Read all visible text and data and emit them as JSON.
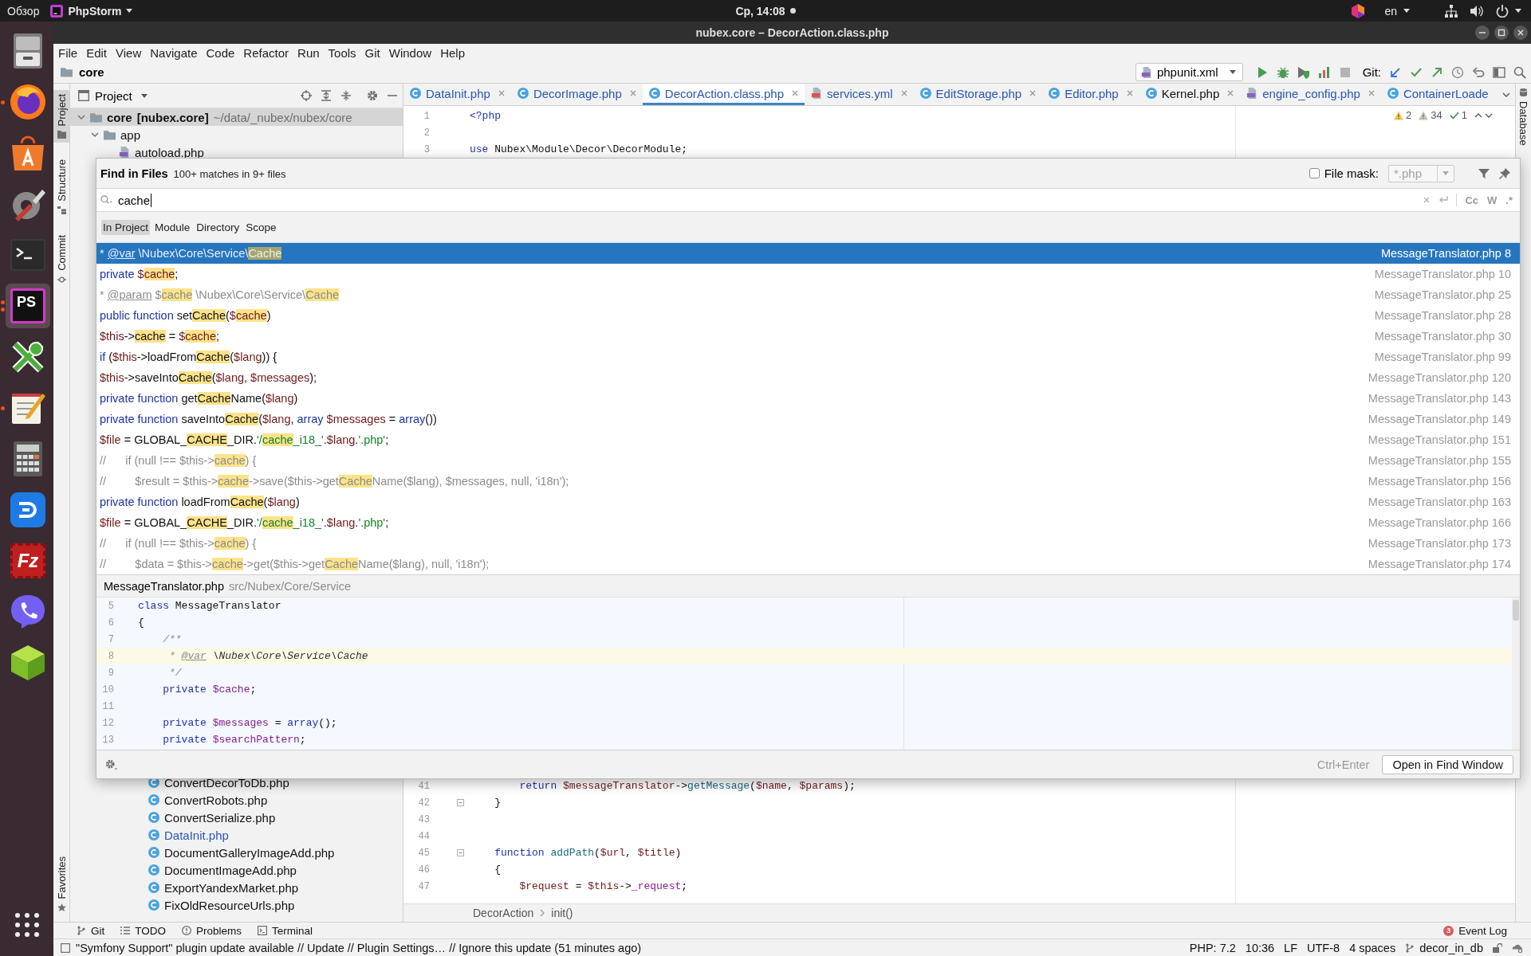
{
  "top_bar": {
    "activities": "Обзор",
    "app_name": "PhpStorm",
    "clock": "Ср, 14:08",
    "notification": true,
    "language": "en"
  },
  "dock": {
    "apps": [
      {
        "kind": "cabinet",
        "running": false,
        "multi_window": false,
        "active": false
      },
      {
        "kind": "browser",
        "running": true,
        "multi_window": false,
        "active": false
      },
      {
        "kind": "store",
        "running": false,
        "multi_window": false,
        "active": false
      },
      {
        "kind": "settings",
        "running": false,
        "multi_window": false,
        "active": false
      },
      {
        "kind": "terminal",
        "running": false,
        "multi_window": false,
        "active": false
      },
      {
        "kind": "ide",
        "label": "PS",
        "running": true,
        "multi_window": true,
        "active": true
      },
      {
        "kind": "keys",
        "running": false,
        "multi_window": false,
        "active": false
      },
      {
        "kind": "notepad",
        "running": true,
        "multi_window": false,
        "active": false
      },
      {
        "kind": "calculator",
        "running": false,
        "multi_window": false,
        "active": false
      },
      {
        "kind": "docs",
        "running": false,
        "multi_window": false,
        "active": false
      },
      {
        "kind": "ftp",
        "label": "Fz",
        "running": false,
        "multi_window": false,
        "active": false
      },
      {
        "kind": "phone",
        "running": false,
        "multi_window": false,
        "active": false
      },
      {
        "kind": "cube",
        "running": false,
        "multi_window": false,
        "active": false
      }
    ]
  },
  "window": {
    "title": "nubex.core – DecorAction.class.php"
  },
  "menu": [
    "File",
    "Edit",
    "View",
    "Navigate",
    "Code",
    "Refactor",
    "Run",
    "Tools",
    "Git",
    "Window",
    "Help"
  ],
  "nav_bar": {
    "crumb": "core",
    "run_config": "phpunit.xml",
    "git_label": "Git:"
  },
  "left_stripe": {
    "top": [
      {
        "kind": "project",
        "label": "Project",
        "selected": true
      },
      {
        "kind": "structure",
        "label": "Structure",
        "selected": false
      },
      {
        "kind": "commit",
        "label": "Commit",
        "selected": false
      }
    ],
    "bottom": [
      {
        "kind": "favorites",
        "label": "Favorites",
        "selected": false
      }
    ]
  },
  "project": {
    "title": "Project",
    "tree": [
      {
        "label": "core",
        "module": "[nubex.core]",
        "path": "~/data/_nubex/nubex/core",
        "kind": "folder",
        "expanded": true,
        "selected": true,
        "children": [
          {
            "label": "app",
            "kind": "folder",
            "expanded": true,
            "selected": false,
            "children": [
              {
                "label": "autoload.php",
                "kind": "php",
                "selected": false
              }
            ]
          }
        ]
      }
    ],
    "lower_files": [
      {
        "label": "ConvertDecorToDb.php",
        "modified": false
      },
      {
        "label": "ConvertRobots.php",
        "modified": false
      },
      {
        "label": "ConvertSerialize.php",
        "modified": false
      },
      {
        "label": "DataInit.php",
        "modified": true
      },
      {
        "label": "DocumentGalleryImageAdd.php",
        "modified": false
      },
      {
        "label": "DocumentImageAdd.php",
        "modified": false
      },
      {
        "label": "ExportYandexMarket.php",
        "modified": false
      },
      {
        "label": "FixOldResourceUrls.php",
        "modified": false
      }
    ]
  },
  "editor": {
    "tabs": [
      {
        "label": "DataInit.php",
        "kind": "class",
        "modified": true,
        "selected": false,
        "closable": true
      },
      {
        "label": "DecorImage.php",
        "kind": "class",
        "modified": true,
        "selected": false,
        "closable": true
      },
      {
        "label": "DecorAction.class.php",
        "kind": "class",
        "modified": true,
        "selected": true,
        "closable": true
      },
      {
        "label": "services.yml",
        "kind": "yaml",
        "modified": true,
        "selected": false,
        "closable": true
      },
      {
        "label": "EditStorage.php",
        "kind": "class",
        "modified": true,
        "selected": false,
        "closable": true
      },
      {
        "label": "Editor.php",
        "kind": "class",
        "modified": true,
        "selected": false,
        "closable": true
      },
      {
        "label": "Kernel.php",
        "kind": "class",
        "modified": false,
        "selected": false,
        "closable": true
      },
      {
        "label": "engine_config.php",
        "kind": "php",
        "modified": true,
        "selected": false,
        "closable": true
      },
      {
        "label": "ContainerLoade",
        "kind": "class",
        "modified": true,
        "selected": false,
        "closable": false
      }
    ],
    "inspections": {
      "warnings": "2",
      "weak_warnings": "34",
      "passed": "1"
    },
    "top_lines": [
      {
        "number": "1",
        "fold": false,
        "tokens": [
          {
            "text": "<?php",
            "kind": "keyword"
          }
        ]
      },
      {
        "number": "2",
        "fold": false
      },
      {
        "number": "3",
        "fold": false,
        "tokens": [
          {
            "text": "use ",
            "kind": "keyword"
          },
          {
            "text": "Nubex\\Module\\Decor\\DecorModule;",
            "kind": "plain"
          }
        ]
      }
    ],
    "bottom_lines": [
      {
        "number": "41",
        "fold": false,
        "tokens": [
          {
            "text": "        return ",
            "kind": "keyword"
          },
          {
            "text": "$messageTranslator",
            "kind": "variable"
          },
          {
            "text": "->",
            "kind": "plain"
          },
          {
            "text": "getMessage",
            "kind": "method"
          },
          {
            "text": "(",
            "kind": "plain"
          },
          {
            "text": "$name",
            "kind": "variable"
          },
          {
            "text": ", ",
            "kind": "plain"
          },
          {
            "text": "$params",
            "kind": "variable"
          },
          {
            "text": ");",
            "kind": "plain"
          }
        ]
      },
      {
        "number": "42",
        "fold": true,
        "tokens": [
          {
            "text": "    }",
            "kind": "plain"
          }
        ]
      },
      {
        "number": "43",
        "fold": false
      },
      {
        "number": "44",
        "fold": false
      },
      {
        "number": "45",
        "fold": true,
        "tokens": [
          {
            "text": "    function ",
            "kind": "keyword"
          },
          {
            "text": "addPath",
            "kind": "method"
          },
          {
            "text": "(",
            "kind": "plain"
          },
          {
            "text": "$url",
            "kind": "variable"
          },
          {
            "text": ", ",
            "kind": "plain"
          },
          {
            "text": "$title",
            "kind": "variable"
          },
          {
            "text": ")",
            "kind": "plain"
          }
        ]
      },
      {
        "number": "46",
        "fold": false,
        "tokens": [
          {
            "text": "    {",
            "kind": "plain"
          }
        ]
      },
      {
        "number": "47",
        "fold": false,
        "tokens": [
          {
            "text": "        $request",
            "kind": "variable"
          },
          {
            "text": " = ",
            "kind": "plain"
          },
          {
            "text": "$this",
            "kind": "variable"
          },
          {
            "text": "->",
            "kind": "plain"
          },
          {
            "text": "_request",
            "kind": "field"
          },
          {
            "text": ";",
            "kind": "plain"
          }
        ]
      }
    ],
    "breadcrumbs": [
      "DecorAction",
      "init()"
    ]
  },
  "right_stripe": [
    {
      "kind": "database",
      "label": "Database",
      "selected": false
    }
  ],
  "find_dialog": {
    "title": "Find in Files",
    "summary": "100+ matches in 9+ files",
    "file_mask": {
      "label": "File mask:",
      "checked": false,
      "value": "*.php"
    },
    "query": "cache",
    "options": [
      {
        "label": "Cc",
        "on": false
      },
      {
        "label": "W",
        "on": false
      },
      {
        "label": ".*",
        "on": false
      }
    ],
    "scopes": [
      {
        "label": "In Project",
        "selected": true
      },
      {
        "label": "Module",
        "selected": false
      },
      {
        "label": "Directory",
        "selected": false
      },
      {
        "label": "Scope",
        "selected": false
      }
    ],
    "results": [
      {
        "selected": true,
        "file": "MessageTranslator.php",
        "line": "8",
        "tokens": [
          {
            "text": "* ",
            "kind": "comment",
            "match": false
          },
          {
            "text": "@var",
            "kind": "doctag",
            "match": false
          },
          {
            "text": " \\Nubex\\Core\\Service\\",
            "kind": "comment",
            "match": false
          },
          {
            "text": "Cache",
            "kind": "comment",
            "match": true
          }
        ]
      },
      {
        "selected": false,
        "file": "MessageTranslator.php",
        "line": "10",
        "tokens": [
          {
            "text": "private ",
            "kind": "keyword",
            "match": false
          },
          {
            "text": "$",
            "kind": "variable",
            "match": false
          },
          {
            "text": "cache",
            "kind": "variable",
            "match": true
          },
          {
            "text": ";",
            "kind": "plain",
            "match": false
          }
        ]
      },
      {
        "selected": false,
        "file": "MessageTranslator.php",
        "line": "25",
        "tokens": [
          {
            "text": "* ",
            "kind": "comment",
            "match": false
          },
          {
            "text": "@param",
            "kind": "doctag",
            "match": false
          },
          {
            "text": " $",
            "kind": "comment",
            "match": false
          },
          {
            "text": "cache",
            "kind": "comment",
            "match": true
          },
          {
            "text": " \\Nubex\\Core\\Service\\",
            "kind": "comment",
            "match": false
          },
          {
            "text": "Cache",
            "kind": "comment",
            "match": true
          }
        ]
      },
      {
        "selected": false,
        "file": "MessageTranslator.php",
        "line": "28",
        "tokens": [
          {
            "text": "public function ",
            "kind": "keyword",
            "match": false
          },
          {
            "text": "set",
            "kind": "plain",
            "match": false
          },
          {
            "text": "Cache",
            "kind": "plain",
            "match": true
          },
          {
            "text": "(",
            "kind": "plain",
            "match": false
          },
          {
            "text": "$",
            "kind": "variable",
            "match": false
          },
          {
            "text": "cache",
            "kind": "variable",
            "match": true
          },
          {
            "text": ")",
            "kind": "plain",
            "match": false
          }
        ]
      },
      {
        "selected": false,
        "file": "MessageTranslator.php",
        "line": "30",
        "tokens": [
          {
            "text": "$this",
            "kind": "variable",
            "match": false
          },
          {
            "text": "->",
            "kind": "plain",
            "match": false
          },
          {
            "text": "cache",
            "kind": "plain",
            "match": true
          },
          {
            "text": " = ",
            "kind": "plain",
            "match": false
          },
          {
            "text": "$",
            "kind": "variable",
            "match": false
          },
          {
            "text": "cache",
            "kind": "variable",
            "match": true
          },
          {
            "text": ";",
            "kind": "plain",
            "match": false
          }
        ]
      },
      {
        "selected": false,
        "file": "MessageTranslator.php",
        "line": "99",
        "tokens": [
          {
            "text": "if",
            "kind": "keyword",
            "match": false
          },
          {
            "text": " (",
            "kind": "plain",
            "match": false
          },
          {
            "text": "$this",
            "kind": "variable",
            "match": false
          },
          {
            "text": "->loadFrom",
            "kind": "plain",
            "match": false
          },
          {
            "text": "Cache",
            "kind": "plain",
            "match": true
          },
          {
            "text": "(",
            "kind": "plain",
            "match": false
          },
          {
            "text": "$lang",
            "kind": "variable",
            "match": false
          },
          {
            "text": ")) {",
            "kind": "plain",
            "match": false
          }
        ]
      },
      {
        "selected": false,
        "file": "MessageTranslator.php",
        "line": "120",
        "tokens": [
          {
            "text": "$this",
            "kind": "variable",
            "match": false
          },
          {
            "text": "->saveInto",
            "kind": "plain",
            "match": false
          },
          {
            "text": "Cache",
            "kind": "plain",
            "match": true
          },
          {
            "text": "(",
            "kind": "plain",
            "match": false
          },
          {
            "text": "$lang",
            "kind": "variable",
            "match": false
          },
          {
            "text": ", ",
            "kind": "plain",
            "match": false
          },
          {
            "text": "$messages",
            "kind": "variable",
            "match": false
          },
          {
            "text": ");",
            "kind": "plain",
            "match": false
          }
        ]
      },
      {
        "selected": false,
        "file": "MessageTranslator.php",
        "line": "143",
        "tokens": [
          {
            "text": "private function ",
            "kind": "keyword",
            "match": false
          },
          {
            "text": "get",
            "kind": "plain",
            "match": false
          },
          {
            "text": "Cache",
            "kind": "plain",
            "match": true
          },
          {
            "text": "Name(",
            "kind": "plain",
            "match": false
          },
          {
            "text": "$lang",
            "kind": "variable",
            "match": false
          },
          {
            "text": ")",
            "kind": "plain",
            "match": false
          }
        ]
      },
      {
        "selected": false,
        "file": "MessageTranslator.php",
        "line": "149",
        "tokens": [
          {
            "text": "private function ",
            "kind": "keyword",
            "match": false
          },
          {
            "text": "saveInto",
            "kind": "plain",
            "match": false
          },
          {
            "text": "Cache",
            "kind": "plain",
            "match": true
          },
          {
            "text": "(",
            "kind": "plain",
            "match": false
          },
          {
            "text": "$lang",
            "kind": "variable",
            "match": false
          },
          {
            "text": ", ",
            "kind": "plain",
            "match": false
          },
          {
            "text": "array ",
            "kind": "keyword",
            "match": false
          },
          {
            "text": "$messages",
            "kind": "variable",
            "match": false
          },
          {
            "text": " = ",
            "kind": "plain",
            "match": false
          },
          {
            "text": "array",
            "kind": "keyword",
            "match": false
          },
          {
            "text": "())",
            "kind": "plain",
            "match": false
          }
        ]
      },
      {
        "selected": false,
        "file": "MessageTranslator.php",
        "line": "151",
        "tokens": [
          {
            "text": "$file",
            "kind": "variable",
            "match": false
          },
          {
            "text": " = GLOBAL_",
            "kind": "plain",
            "match": false
          },
          {
            "text": "CACHE",
            "kind": "plain",
            "match": true
          },
          {
            "text": "_DIR.",
            "kind": "plain",
            "match": false
          },
          {
            "text": "'/",
            "kind": "string",
            "match": false
          },
          {
            "text": "cache",
            "kind": "string",
            "match": true
          },
          {
            "text": "_i18_'",
            "kind": "string",
            "match": false
          },
          {
            "text": ".",
            "kind": "plain",
            "match": false
          },
          {
            "text": "$lang",
            "kind": "variable",
            "match": false
          },
          {
            "text": ".",
            "kind": "plain",
            "match": false
          },
          {
            "text": "'.php'",
            "kind": "string",
            "match": false
          },
          {
            "text": ";",
            "kind": "plain",
            "match": false
          }
        ]
      },
      {
        "selected": false,
        "file": "MessageTranslator.php",
        "line": "155",
        "tokens": [
          {
            "text": "//      if (null !== $this->",
            "kind": "comment",
            "match": false
          },
          {
            "text": "cache",
            "kind": "comment",
            "match": true
          },
          {
            "text": ") {",
            "kind": "comment",
            "match": false
          }
        ]
      },
      {
        "selected": false,
        "file": "MessageTranslator.php",
        "line": "156",
        "tokens": [
          {
            "text": "//         $result = $this->",
            "kind": "comment",
            "match": false
          },
          {
            "text": "cache",
            "kind": "comment",
            "match": true
          },
          {
            "text": "->save($this->get",
            "kind": "comment",
            "match": false
          },
          {
            "text": "Cache",
            "kind": "comment",
            "match": true
          },
          {
            "text": "Name($lang), $messages, null, 'i18n');",
            "kind": "comment",
            "match": false
          }
        ]
      },
      {
        "selected": false,
        "file": "MessageTranslator.php",
        "line": "163",
        "tokens": [
          {
            "text": "private function ",
            "kind": "keyword",
            "match": false
          },
          {
            "text": "loadFrom",
            "kind": "plain",
            "match": false
          },
          {
            "text": "Cache",
            "kind": "plain",
            "match": true
          },
          {
            "text": "(",
            "kind": "plain",
            "match": false
          },
          {
            "text": "$lang",
            "kind": "variable",
            "match": false
          },
          {
            "text": ")",
            "kind": "plain",
            "match": false
          }
        ]
      },
      {
        "selected": false,
        "file": "MessageTranslator.php",
        "line": "166",
        "tokens": [
          {
            "text": "$file",
            "kind": "variable",
            "match": false
          },
          {
            "text": " = GLOBAL_",
            "kind": "plain",
            "match": false
          },
          {
            "text": "CACHE",
            "kind": "plain",
            "match": true
          },
          {
            "text": "_DIR.",
            "kind": "plain",
            "match": false
          },
          {
            "text": "'/",
            "kind": "string",
            "match": false
          },
          {
            "text": "cache",
            "kind": "string",
            "match": true
          },
          {
            "text": "_i18_'",
            "kind": "string",
            "match": false
          },
          {
            "text": ".",
            "kind": "plain",
            "match": false
          },
          {
            "text": "$lang",
            "kind": "variable",
            "match": false
          },
          {
            "text": ".",
            "kind": "plain",
            "match": false
          },
          {
            "text": "'.php'",
            "kind": "string",
            "match": false
          },
          {
            "text": ";",
            "kind": "plain",
            "match": false
          }
        ]
      },
      {
        "selected": false,
        "file": "MessageTranslator.php",
        "line": "173",
        "tokens": [
          {
            "text": "//      if (null !== $this->",
            "kind": "comment",
            "match": false
          },
          {
            "text": "cache",
            "kind": "comment",
            "match": true
          },
          {
            "text": ") {",
            "kind": "comment",
            "match": false
          }
        ]
      },
      {
        "selected": false,
        "file": "MessageTranslator.php",
        "line": "174",
        "tokens": [
          {
            "text": "//         $data = $this->",
            "kind": "comment",
            "match": false
          },
          {
            "text": "cache",
            "kind": "comment",
            "match": true
          },
          {
            "text": "->get($this->get",
            "kind": "comment",
            "match": false
          },
          {
            "text": "Cache",
            "kind": "comment",
            "match": true
          },
          {
            "text": "Name($lang), null, 'i18n');",
            "kind": "comment",
            "match": false
          }
        ]
      }
    ],
    "preview": {
      "file": "MessageTranslator.php",
      "path": "src/Nubex/Core/Service",
      "lines": [
        {
          "number": "5",
          "current": false,
          "tokens": [
            {
              "text": "class ",
              "kind": "keyword"
            },
            {
              "text": "MessageTranslator",
              "kind": "plain"
            }
          ]
        },
        {
          "number": "6",
          "current": false,
          "tokens": [
            {
              "text": "{",
              "kind": "plain"
            }
          ]
        },
        {
          "number": "7",
          "current": false,
          "tokens": [
            {
              "text": "    /**",
              "kind": "comment"
            }
          ]
        },
        {
          "number": "8",
          "current": true,
          "tokens": [
            {
              "text": "     * ",
              "kind": "comment"
            },
            {
              "text": "@var",
              "kind": "doctag"
            },
            {
              "text": " \\Nubex\\Core\\Service\\Cache",
              "kind": "doctype"
            }
          ]
        },
        {
          "number": "9",
          "current": false,
          "tokens": [
            {
              "text": "     */",
              "kind": "comment"
            }
          ]
        },
        {
          "number": "10",
          "current": false,
          "tokens": [
            {
              "text": "    private ",
              "kind": "keyword"
            },
            {
              "text": "$cache",
              "kind": "field"
            },
            {
              "text": ";",
              "kind": "plain"
            }
          ]
        },
        {
          "number": "11",
          "current": false
        },
        {
          "number": "12",
          "current": false,
          "tokens": [
            {
              "text": "    private ",
              "kind": "keyword"
            },
            {
              "text": "$messages",
              "kind": "field"
            },
            {
              "text": " = ",
              "kind": "plain"
            },
            {
              "text": "array",
              "kind": "keyword"
            },
            {
              "text": "();",
              "kind": "plain"
            }
          ]
        },
        {
          "number": "13",
          "current": false,
          "tokens": [
            {
              "text": "    private ",
              "kind": "keyword"
            },
            {
              "text": "$searchPattern",
              "kind": "field"
            },
            {
              "text": ";",
              "kind": "plain"
            }
          ]
        }
      ]
    },
    "shortcut": "Ctrl+Enter",
    "open_button": "Open in Find Window"
  },
  "tool_buttons": [
    {
      "kind": "git",
      "label": "Git"
    },
    {
      "kind": "todo",
      "label": "TODO"
    },
    {
      "kind": "problems",
      "label": "Problems"
    },
    {
      "kind": "terminal",
      "label": "Terminal"
    }
  ],
  "event_log": {
    "label": "Event Log",
    "count": "3"
  },
  "status_bar": {
    "message": "\"Symfony Support\" plugin update available // Update // Plugin Settings… // Ignore this update (51 minutes ago)",
    "items": [
      "PHP: 7.2",
      "10:36",
      "LF",
      "UTF-8",
      "4 spaces"
    ],
    "branch": "decor_in_db"
  }
}
